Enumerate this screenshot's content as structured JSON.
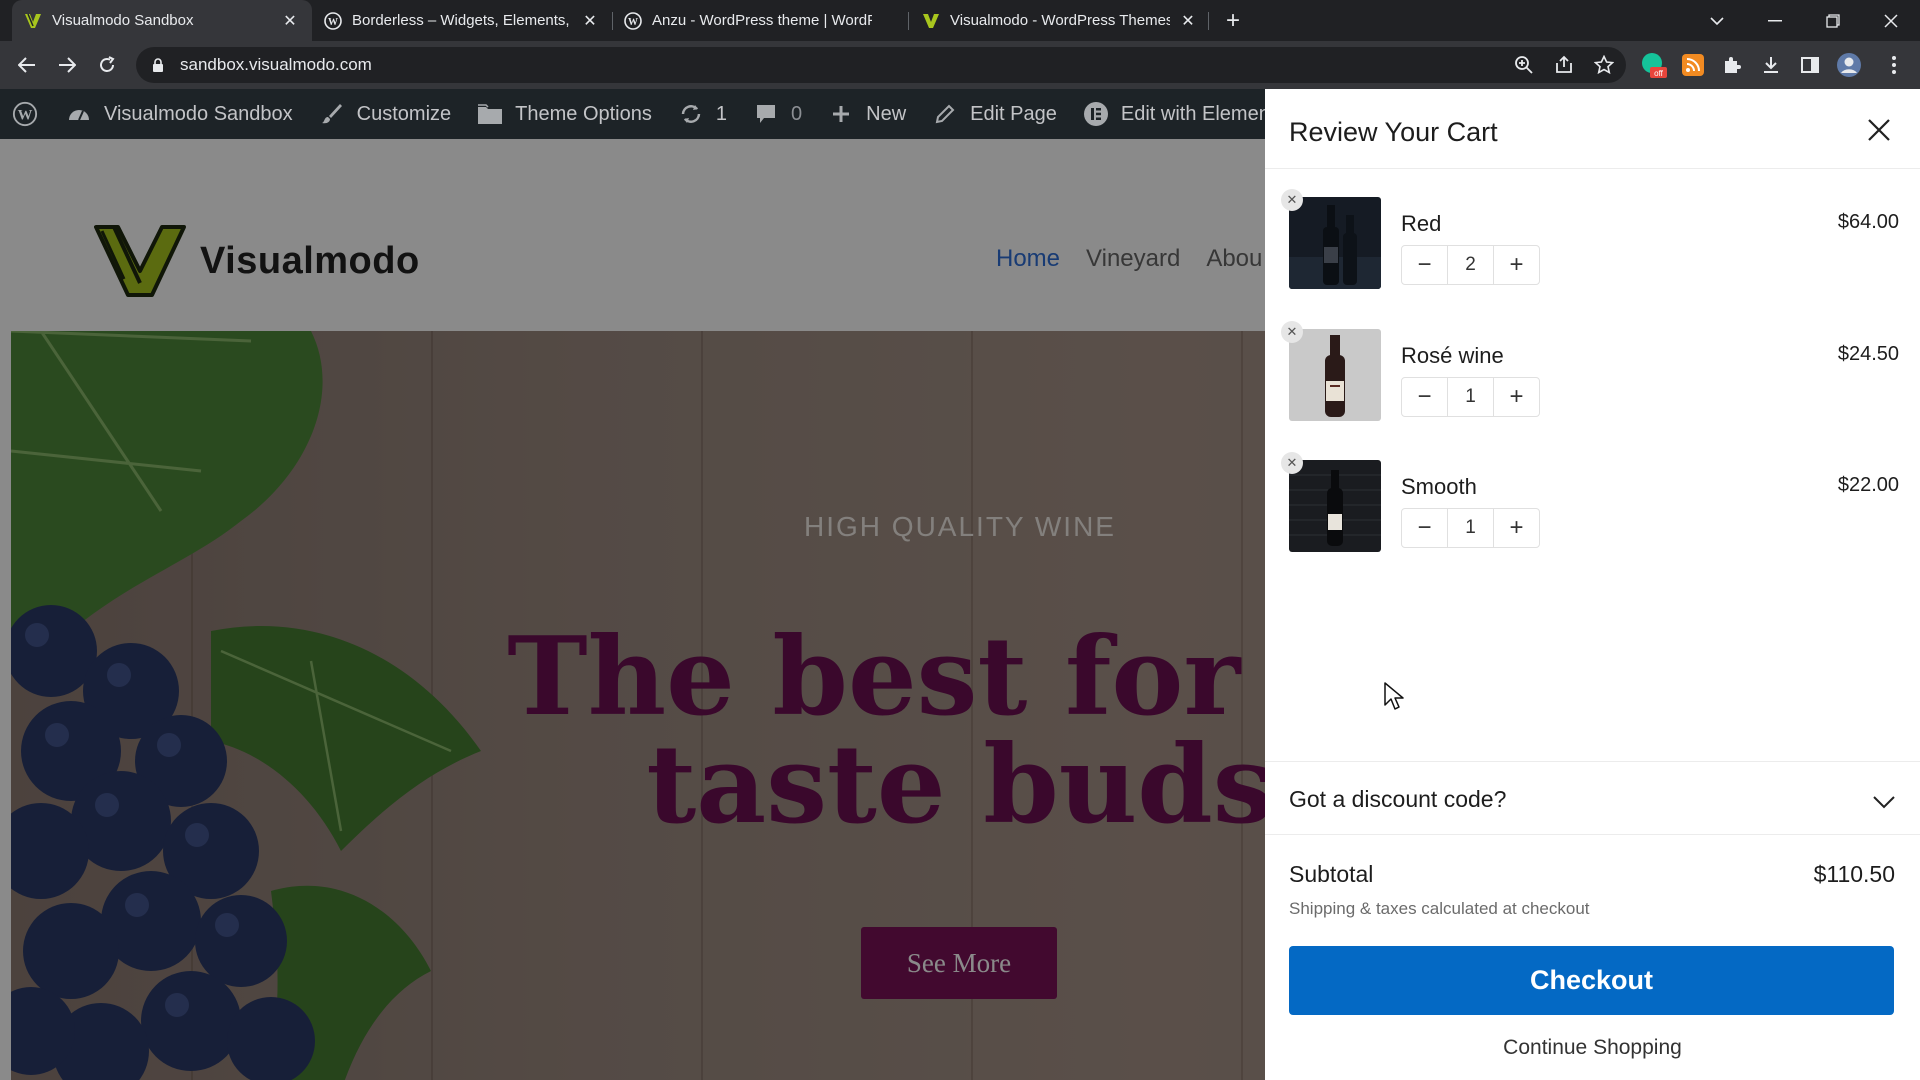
{
  "browser": {
    "tabs": [
      {
        "title": "Visualmodo Sandbox",
        "active": true
      },
      {
        "title": "Borderless – Widgets, Elements, T",
        "active": false
      },
      {
        "title": "Anzu - WordPress theme | WordP",
        "active": false
      },
      {
        "title": "Visualmodo - WordPress Themes",
        "active": false
      }
    ],
    "url": "sandbox.visualmodo.com",
    "extension_badge": "off"
  },
  "adminbar": {
    "site_name": "Visualmodo Sandbox",
    "customize": "Customize",
    "theme_options": "Theme Options",
    "updates_count": "1",
    "comments_count": "0",
    "new": "New",
    "edit_page": "Edit Page",
    "edit_with_elementor": "Edit with Elemen"
  },
  "site": {
    "brand": "Visualmodo",
    "nav": [
      "Home",
      "Vineyard",
      "Abou"
    ],
    "hero_kicker": "HIGH QUALITY WINE",
    "hero_title_line1": "The best for yo",
    "hero_title_line2": "taste buds",
    "hero_button": "See More"
  },
  "cart": {
    "title": "Review Your Cart",
    "items": [
      {
        "name": "Red",
        "price": "$64.00",
        "qty": "2"
      },
      {
        "name": "Rosé wine",
        "price": "$24.50",
        "qty": "1"
      },
      {
        "name": "Smooth",
        "price": "$22.00",
        "qty": "1"
      }
    ],
    "discount_label": "Got a discount code?",
    "subtotal_label": "Subtotal",
    "subtotal_value": "$110.50",
    "shipping_note": "Shipping & taxes calculated at checkout",
    "checkout_label": "Checkout",
    "continue_label": "Continue Shopping",
    "minus": "−",
    "plus": "+"
  },
  "colors": {
    "accent_blue": "#0469c4",
    "hero_title": "#6b0f52",
    "hero_button": "#7a1158",
    "nav_active": "#2e6ed6",
    "adminbar_bg": "#1d2327"
  }
}
